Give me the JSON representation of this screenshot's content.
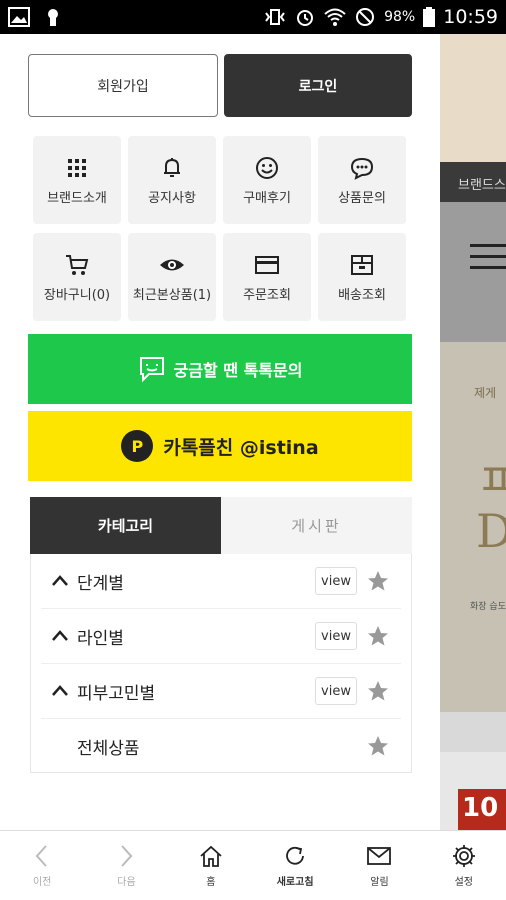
{
  "status_bar": {
    "battery_percent": "98%",
    "time": "10:59"
  },
  "drawer": {
    "auth": {
      "join_label": "회원가입",
      "login_label": "로그인"
    },
    "menu_tiles": [
      {
        "label": "브랜드소개",
        "icon": "grid-icon"
      },
      {
        "label": "공지사항",
        "icon": "bell-icon"
      },
      {
        "label": "구매후기",
        "icon": "smile-icon"
      },
      {
        "label": "상품문의",
        "icon": "chat-bubble-icon"
      },
      {
        "label": "장바구니(0)",
        "icon": "cart-icon"
      },
      {
        "label": "최근본상품(1)",
        "icon": "eye-icon"
      },
      {
        "label": "주문조회",
        "icon": "card-icon"
      },
      {
        "label": "배송조회",
        "icon": "box-icon"
      }
    ],
    "talk_button_label": "궁금할 땐 톡톡문의",
    "kakao_button_label": "카톡플친 @istina",
    "kakao_badge": "P",
    "tabs": {
      "category": "카테고리",
      "board": "게시판"
    },
    "categories": [
      {
        "name": "단계별",
        "view": "view"
      },
      {
        "name": "라인별",
        "view": "view"
      },
      {
        "name": "피부고민별",
        "view": "view"
      },
      {
        "name": "전체상품"
      }
    ]
  },
  "background_page": {
    "strip_text": "브랜드스",
    "small_text": "제게",
    "big_glyph_1": "ㅍ",
    "big_glyph_2": "D",
    "fine_text": "화장 습도",
    "red_badge": "10"
  },
  "bottom_nav": [
    {
      "label": "이전",
      "icon": "chevron-left-icon"
    },
    {
      "label": "다음",
      "icon": "chevron-right-icon"
    },
    {
      "label": "홈",
      "icon": "home-icon"
    },
    {
      "label": "새로고침",
      "icon": "refresh-icon"
    },
    {
      "label": "알림",
      "icon": "mail-icon"
    },
    {
      "label": "설정",
      "icon": "gear-icon"
    }
  ],
  "colors": {
    "talk_green": "#1ec84a",
    "kakao_yellow": "#fee500",
    "dark": "#333333"
  }
}
